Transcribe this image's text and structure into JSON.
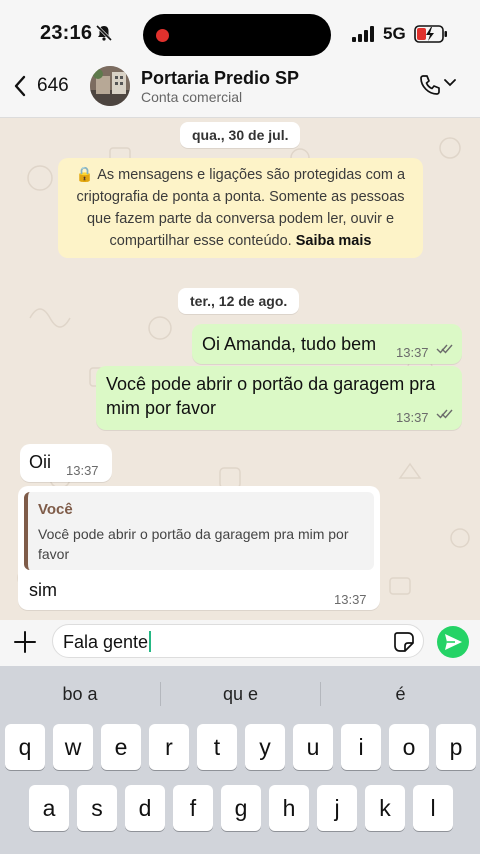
{
  "status_bar": {
    "time": "23:16",
    "network": "5G"
  },
  "header": {
    "back_count": "646",
    "contact_name": "Portaria Predio SP",
    "contact_subtitle": "Conta comercial"
  },
  "chat": {
    "date_1": "qua., 30 de jul.",
    "encryption_notice": "🔒 As mensagens e ligações são protegidas com a criptografia de ponta a ponta. Somente as pessoas que fazem parte da conversa podem ler, ouvir e compartilhar esse conteúdo.",
    "encryption_link": "Saiba mais",
    "date_2": "ter., 12 de ago.",
    "messages": [
      {
        "direction": "out",
        "text": "Oi Amanda, tudo bem",
        "time": "13:37",
        "status": "read"
      },
      {
        "direction": "out",
        "text": "Você pode abrir o portão da garagem pra mim por favor",
        "time": "13:37",
        "status": "read"
      },
      {
        "direction": "in",
        "text": "Oii",
        "time": "13:37"
      },
      {
        "direction": "in",
        "quote_author": "Você",
        "quote_text": "Você pode abrir o portão da garagem pra mim por favor",
        "text": "sim",
        "time": "13:37"
      }
    ]
  },
  "composer": {
    "value": "Fala gente"
  },
  "keyboard": {
    "suggestions": [
      "bo a",
      "qu e",
      "é"
    ],
    "row1": [
      "q",
      "w",
      "e",
      "r",
      "t",
      "y",
      "u",
      "i",
      "o",
      "p"
    ],
    "row2": [
      "a",
      "s",
      "d",
      "f",
      "g",
      "h",
      "j",
      "k",
      "l"
    ]
  },
  "colors": {
    "outgoing_bubble": "#dbf9c6",
    "incoming_bubble": "#ffffff",
    "send_button": "#25d366",
    "read_ticks": "#53bdeb"
  }
}
